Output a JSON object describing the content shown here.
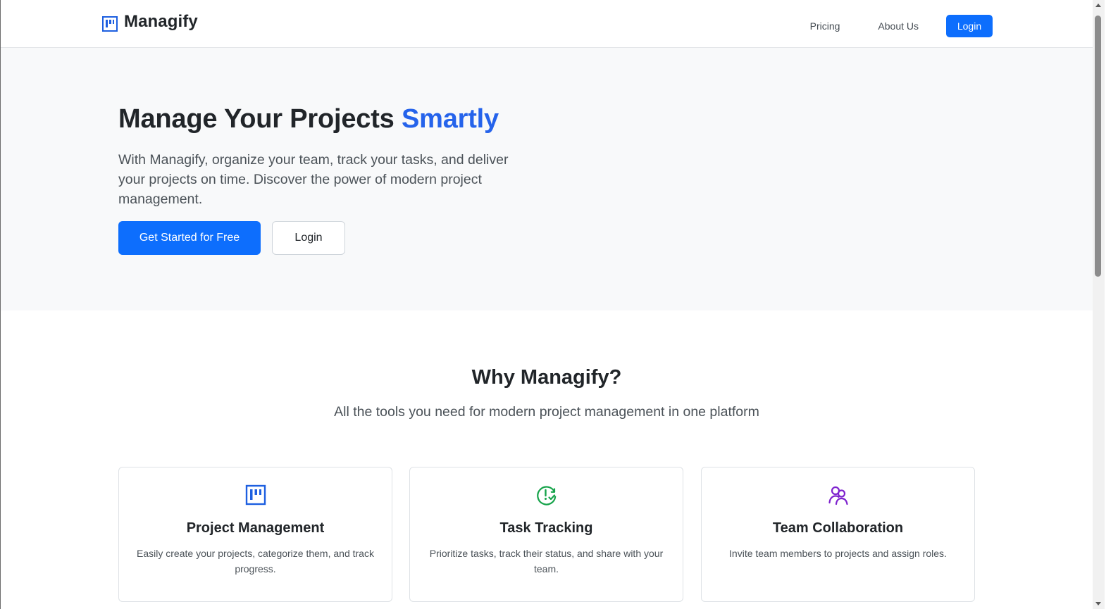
{
  "navbar": {
    "brand_name": "Managify",
    "links": [
      "Pricing",
      "About Us"
    ],
    "login_label": "Login"
  },
  "hero": {
    "title_main": "Manage Your Projects ",
    "title_accent": "Smartly",
    "description": "With Managify, organize your team, track your tasks, and deliver your projects on time. Discover the power of modern project management.",
    "primary_cta": "Get Started for Free",
    "secondary_cta": "Login"
  },
  "features": {
    "title": "Why Managify?",
    "subtitle": "All the tools you need for modern project management in one platform",
    "cards": [
      {
        "icon": "kanban-icon",
        "title": "Project Management",
        "description": "Easily create your projects, categorize them, and track progress."
      },
      {
        "icon": "clock-check-icon",
        "title": "Task Tracking",
        "description": "Prioritize tasks, track their status, and share with your team."
      },
      {
        "icon": "people-icon",
        "title": "Team Collaboration",
        "description": "Invite team members to projects and assign roles."
      }
    ]
  },
  "colors": {
    "primary": "#0d6efd",
    "accent_text": "#2563eb",
    "hero_background": "#f8f9fa",
    "icon_blue": "#1d5fe0",
    "icon_green": "#16a34a",
    "icon_purple": "#7e22ce"
  }
}
